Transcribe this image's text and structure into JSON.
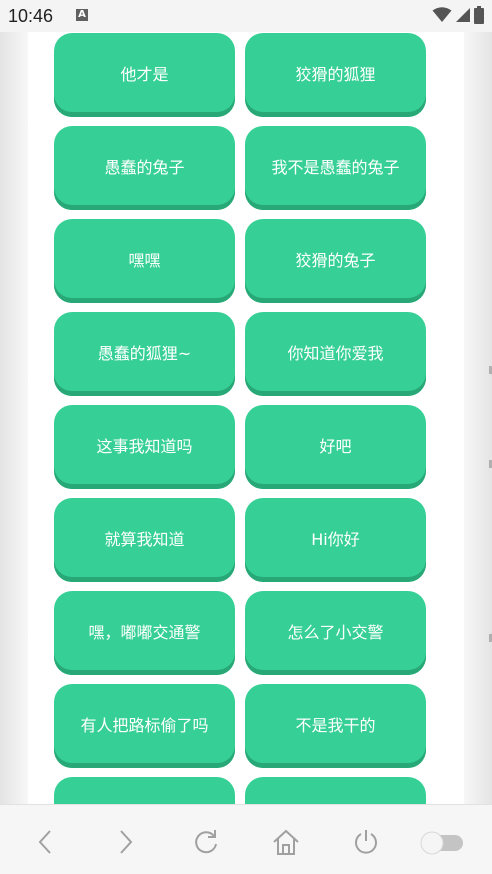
{
  "status_bar": {
    "time": "10:46",
    "app_indicator": "A"
  },
  "phrase_buttons": [
    {
      "label": "他才是"
    },
    {
      "label": "狡猾的狐狸"
    },
    {
      "label": "愚蠢的兔子"
    },
    {
      "label": "我不是愚蠢的兔子"
    },
    {
      "label": "嘿嘿"
    },
    {
      "label": "狡猾的兔子"
    },
    {
      "label": "愚蠢的狐狸~"
    },
    {
      "label": "你知道你爱我"
    },
    {
      "label": "这事我知道吗"
    },
    {
      "label": "好吧"
    },
    {
      "label": "就算我知道"
    },
    {
      "label": "Hi你好"
    },
    {
      "label": "嘿，嘟嘟交通警"
    },
    {
      "label": "怎么了小交警"
    },
    {
      "label": "有人把路标偷了吗"
    },
    {
      "label": "不是我干的"
    },
    {
      "label": ""
    },
    {
      "label": ""
    }
  ],
  "bottom_nav": {
    "icons": [
      "back-arrow-icon",
      "forward-arrow-icon",
      "refresh-icon",
      "home-icon",
      "power-icon",
      "toggle-switch-icon"
    ],
    "toggle_state": "off"
  },
  "colors": {
    "button_green": "#36d096",
    "button_shadow": "#28a876",
    "nav_icon_gray": "#a0a0a0"
  }
}
